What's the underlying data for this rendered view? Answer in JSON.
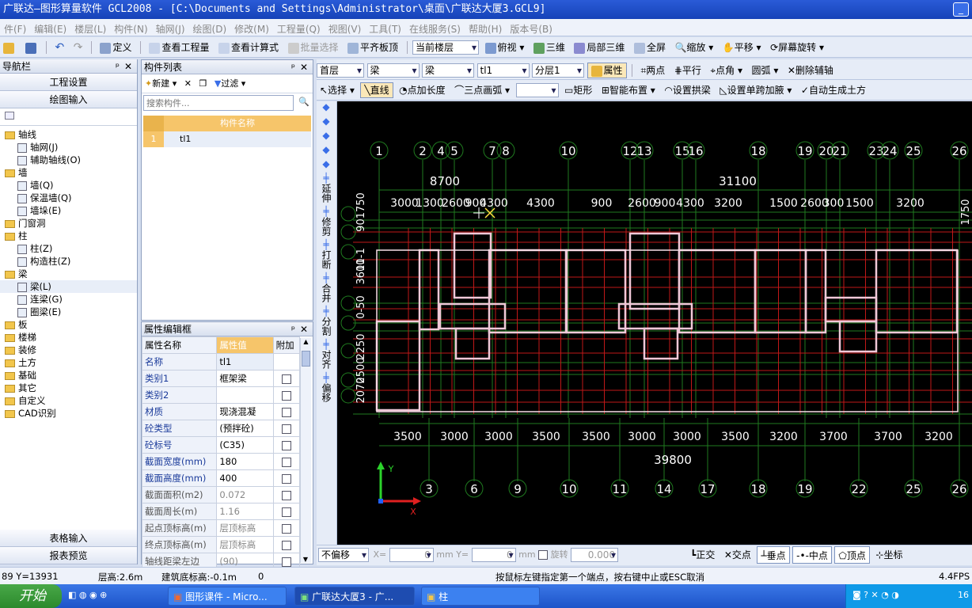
{
  "window": {
    "title": "广联达—图形算量软件 GCL2008 - [C:\\Documents and Settings\\Administrator\\桌面\\广联达大厦3.GCL9]",
    "minimize": "_"
  },
  "menu": [
    "件(F)",
    "编辑(E)",
    "楼层(L)",
    "构件(N)",
    "轴网(J)",
    "绘图(D)",
    "修改(M)",
    "工程量(Q)",
    "视图(V)",
    "工具(T)",
    "在线服务(S)",
    "帮助(H)",
    "版本号(B)"
  ],
  "toolbar1": {
    "define": "定义",
    "view_qty": "查看工程量",
    "view_formula": "查看计算式",
    "batch_select": "批量选择",
    "level_slab": "平齐板顶",
    "current_floor": "当前楼层",
    "top_view": "俯视",
    "three_d": "三维",
    "local_3d": "局部三维",
    "fullscreen": "全屏",
    "zoom": "缩放",
    "pan": "平移",
    "rotate": "屏幕旋转"
  },
  "toolbar2": {
    "floor": "首层",
    "type": "梁",
    "subtype": "梁",
    "comp": "tl1",
    "layer": "分层1",
    "attr": "属性",
    "two_point": "两点",
    "parallel": "平行",
    "point_angle": "点角",
    "arc": "圆弧",
    "del_aux": "删除辅轴"
  },
  "toolbar3": {
    "select": "选择",
    "line": "直线",
    "point_len": "点加长度",
    "three_pt_arc": "三点画弧",
    "rect": "矩形",
    "smart": "智能布置",
    "set_arch": "设置拱梁",
    "set_span": "设置单跨加腋",
    "auto_earth": "自动生成土方"
  },
  "nav": {
    "title": "导航栏",
    "proj": "工程设置",
    "draw": "绘图输入",
    "table_input": "表格输入",
    "report": "报表预览",
    "tree": [
      {
        "label": "轴线",
        "kind": "folder",
        "level": 0
      },
      {
        "label": "轴网(J)",
        "kind": "leaf",
        "level": 1
      },
      {
        "label": "辅助轴线(O)",
        "kind": "leaf",
        "level": 1
      },
      {
        "label": "墙",
        "kind": "folder",
        "level": 0
      },
      {
        "label": "墙(Q)",
        "kind": "leaf",
        "level": 1
      },
      {
        "label": "保温墙(Q)",
        "kind": "leaf",
        "level": 1
      },
      {
        "label": "墙垛(E)",
        "kind": "leaf",
        "level": 1
      },
      {
        "label": "门窗洞",
        "kind": "folder",
        "level": 0
      },
      {
        "label": "柱",
        "kind": "folder",
        "level": 0
      },
      {
        "label": "柱(Z)",
        "kind": "leaf",
        "level": 1
      },
      {
        "label": "构造柱(Z)",
        "kind": "leaf",
        "level": 1
      },
      {
        "label": "梁",
        "kind": "folder",
        "level": 0
      },
      {
        "label": "梁(L)",
        "kind": "leaf",
        "level": 1
      },
      {
        "label": "连梁(G)",
        "kind": "leaf",
        "level": 1
      },
      {
        "label": "圈梁(E)",
        "kind": "leaf",
        "level": 1
      },
      {
        "label": "板",
        "kind": "folder",
        "level": 0
      },
      {
        "label": "楼梯",
        "kind": "folder",
        "level": 0
      },
      {
        "label": "装修",
        "kind": "folder",
        "level": 0
      },
      {
        "label": "土方",
        "kind": "folder",
        "level": 0
      },
      {
        "label": "基础",
        "kind": "folder",
        "level": 0
      },
      {
        "label": "其它",
        "kind": "folder",
        "level": 0
      },
      {
        "label": "自定义",
        "kind": "folder",
        "level": 0
      },
      {
        "label": "CAD识别",
        "kind": "folder",
        "level": 0
      }
    ]
  },
  "complist": {
    "title": "构件列表",
    "new": "新建",
    "filter": "过滤",
    "search_placeholder": "搜索构件...",
    "col": "构件名称",
    "rows": [
      {
        "idx": "1",
        "name": "tl1"
      }
    ]
  },
  "props": {
    "title": "属性编辑框",
    "col_name": "属性名称",
    "col_value": "属性值",
    "col_add": "附加",
    "rows": [
      {
        "name": "名称",
        "value": "tl1",
        "blue": true
      },
      {
        "name": "类别1",
        "value": "框架梁",
        "blue": true
      },
      {
        "name": "类别2",
        "value": "",
        "blue": true
      },
      {
        "name": "材质",
        "value": "现浇混凝",
        "blue": true
      },
      {
        "name": "砼类型",
        "value": "(预拌砼)",
        "blue": true
      },
      {
        "name": "砼标号",
        "value": "(C35)",
        "blue": true
      },
      {
        "name": "截面宽度(mm)",
        "value": "180",
        "blue": true
      },
      {
        "name": "截面高度(mm)",
        "value": "400",
        "blue": true
      },
      {
        "name": "截面面积(m2)",
        "value": "0.072",
        "blue": false
      },
      {
        "name": "截面周长(m)",
        "value": "1.16",
        "blue": false
      },
      {
        "name": "起点顶标高(m)",
        "value": "层顶标高",
        "blue": false
      },
      {
        "name": "终点顶标高(m)",
        "value": "层顶标高",
        "blue": false
      },
      {
        "name": "轴线距梁左边",
        "value": "(90)",
        "blue": false
      }
    ]
  },
  "vtools": [
    "延伸",
    "修剪",
    "打断",
    "合并",
    "分割",
    "对齐",
    "偏移"
  ],
  "canvas": {
    "top_axes": [
      "1",
      "2",
      "4",
      "5",
      "7",
      "8",
      "10",
      "12",
      "13",
      "15",
      "16",
      "18",
      "19",
      "20",
      "21",
      "23",
      "24",
      "25",
      "26"
    ],
    "bottom_axes": [
      "3",
      "6",
      "9",
      "10",
      "11",
      "14",
      "17",
      "18",
      "19",
      "22",
      "25",
      "26"
    ],
    "top_total_left": "8700",
    "top_total_right": "31100",
    "top_dims": [
      "3000",
      "1300",
      "2600",
      "900",
      "4300",
      "4300",
      "900",
      "2600",
      "900",
      "4300",
      "3200",
      "1500",
      "2600",
      "300",
      "1500",
      "3200"
    ],
    "bottom_dims": [
      "3500",
      "3000",
      "3000",
      "3500",
      "3500",
      "3000",
      "3000",
      "3500",
      "3200",
      "3700",
      "3700",
      "3200"
    ],
    "bottom_total": "39800",
    "left_dims": [
      "901750",
      "11-1",
      "3600",
      "0-50",
      "2250",
      "2500",
      "2070"
    ],
    "right_dim": "1750",
    "y_label": "Y",
    "x_label": "X"
  },
  "bottom": {
    "offset": "不偏移",
    "x": "X=",
    "y": "Y=",
    "mm": "mm",
    "rotate": "旋转",
    "angle": "0.000",
    "ortho": "正交",
    "intersect": "交点",
    "perp": "垂点",
    "mid": "中点",
    "vertex": "顶点",
    "coord": "坐标"
  },
  "status": {
    "coords": "89 Y=13931",
    "floor_h": "层高:2.6m",
    "base_h": "建筑底标高:-0.1m",
    "zero": "0",
    "hint": "按鼠标左键指定第一个端点，按右键中止或ESC取消",
    "fps": "4.4FPS"
  },
  "taskbar": {
    "start": "开始",
    "tasks": [
      "图形课件 - Micro...",
      "广联达大厦3 - 广...",
      "柱"
    ],
    "time": "16"
  }
}
